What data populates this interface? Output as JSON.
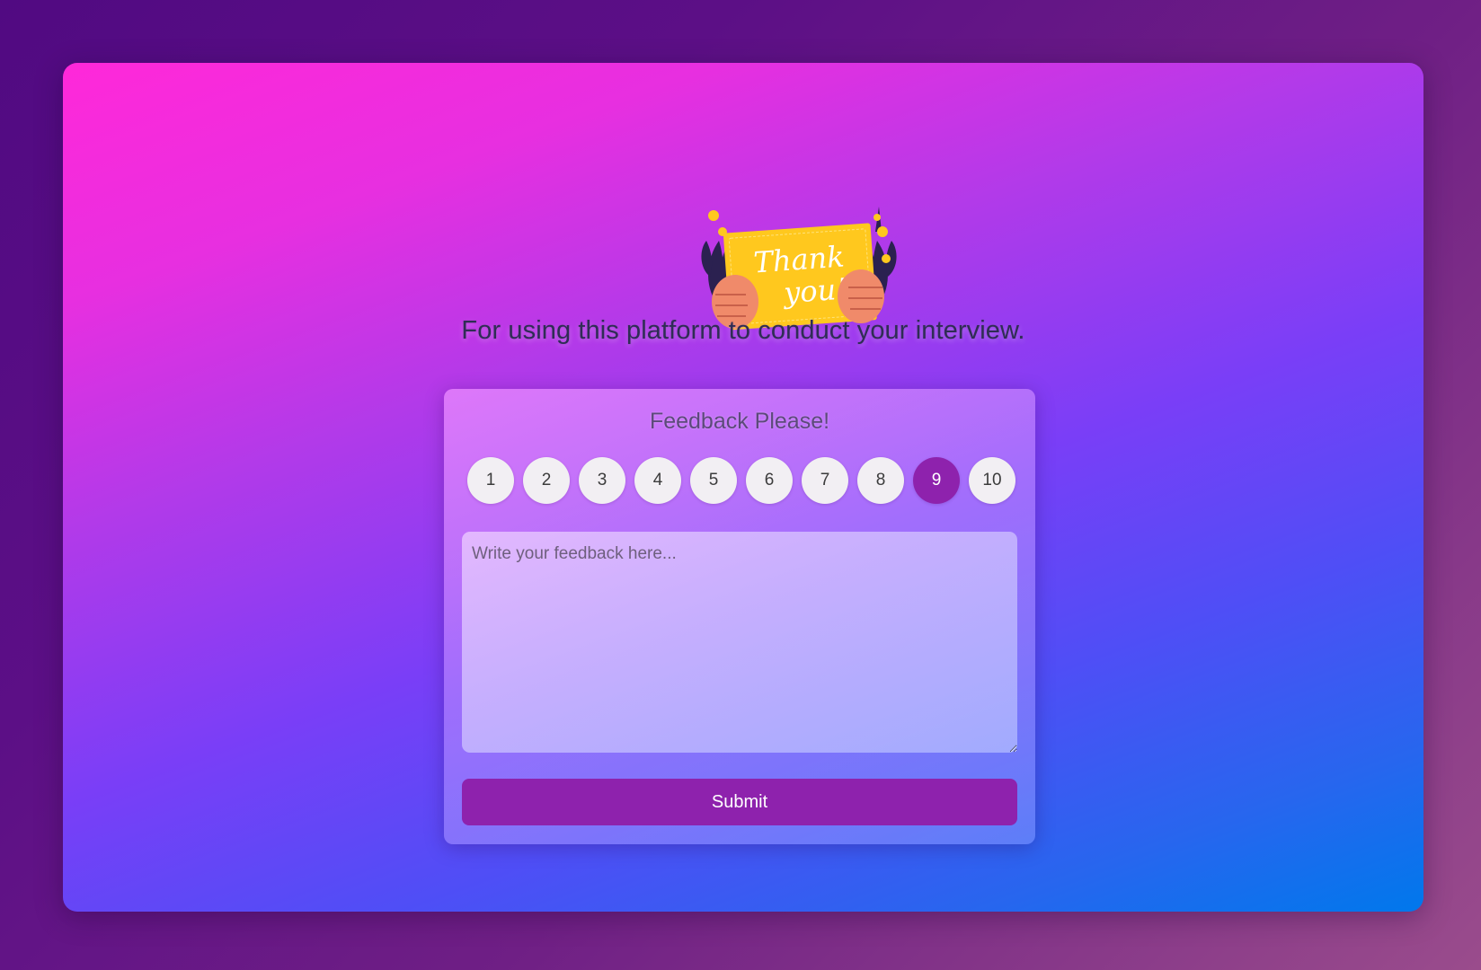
{
  "illustration": {
    "name": "thank-you-card-illustration",
    "text_line1": "Thank",
    "text_line2": "you!",
    "colors": {
      "card": "#ffc81e",
      "hands": "#f08a6a",
      "leaves": "#2b2150",
      "flowers": "#ffc81e"
    }
  },
  "tagline": "For using this platform to conduct your interview.",
  "feedback": {
    "title": "Feedback Please!",
    "ratings": [
      "1",
      "2",
      "3",
      "4",
      "5",
      "6",
      "7",
      "8",
      "9",
      "10"
    ],
    "selected_rating": "9",
    "textarea_placeholder": "Write your feedback here...",
    "textarea_value": "",
    "submit_label": "Submit"
  },
  "colors": {
    "accent": "#8e22ad",
    "rating_bg": "#f2eff3",
    "tagline": "#2f2d55"
  }
}
